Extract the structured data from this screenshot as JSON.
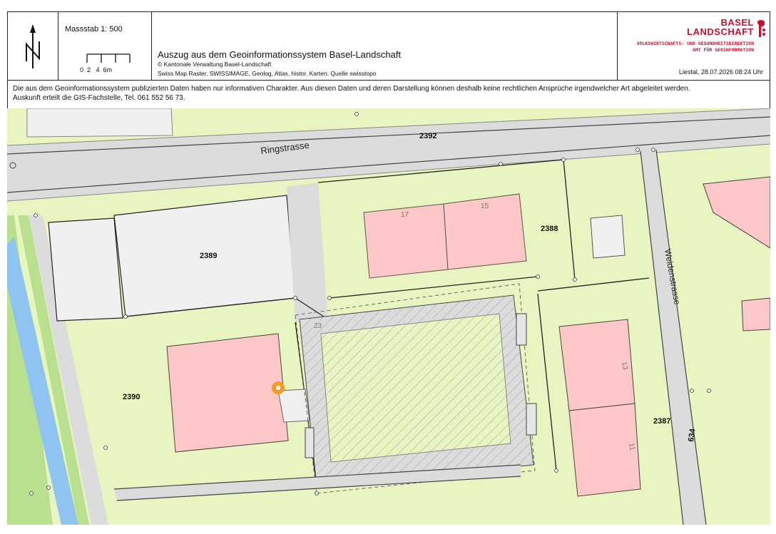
{
  "header": {
    "scale_label": "Massstab 1: 500",
    "scale_ticks": "0  2   4  6m",
    "title": "Auszug aus dem Geoinformationssystem Basel-Landschaft",
    "copyright": "© Kantonale Verwaltung Basel-Landschaft",
    "sources": "Swiss Map Raster, SWISSIMAGE, Geolog. Atlas, histor. Karten: Quelle swisstopo",
    "brand_line1": "BASEL",
    "brand_line2": "LANDSCHAFT",
    "directorate_line1": "VOLKSWIRTSCHAFTS- UND GESUNDHEITSDIREKTION",
    "directorate_line2": "AMT FÜR GEOINFORMATION",
    "place_date": "Liestal, 28.07.2026 08:24 Uhr"
  },
  "disclaimer": {
    "line1": "Die aus dem Geoinformationssystem publizierten Daten haben nur informativen Charakter. Aus diesen Daten und deren Darstellung können deshalb keine rechtlichen Ansprüche irgendwelcher Art abgeleitet werden.",
    "line2": "Auskunft erteilt die GIS-Fachstelle, Tel. 061 552 56 73."
  },
  "map": {
    "streets": {
      "ringstrasse": "Ringstrasse",
      "weidenstrasse": "Weidenstrasse"
    },
    "parcels": {
      "p2392": "2392",
      "p2389": "2389",
      "p2388": "2388",
      "p2390": "2390",
      "p2387": "2387",
      "p634": "634"
    },
    "house_numbers": {
      "h17": "17",
      "h15": "15",
      "h23": "23",
      "h13": "13",
      "h11": "11"
    },
    "colors": {
      "parcel_fill": "#e9f5c0",
      "building_fill": "#ffc8c8",
      "road_fill": "#dcdcdc",
      "water_fill": "#8fc3f0",
      "bank_fill": "#b9e08e",
      "marker": "#f39c21"
    }
  }
}
